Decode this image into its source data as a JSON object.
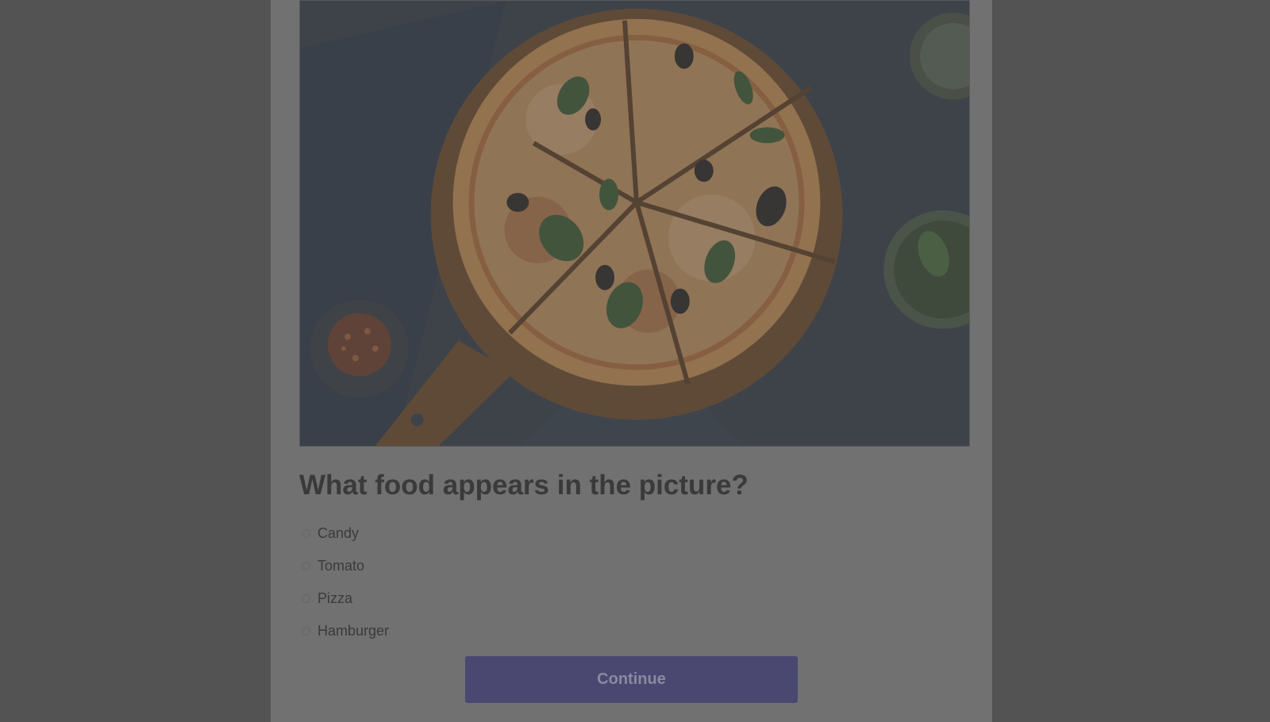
{
  "quiz": {
    "image": {
      "subject": "pizza-photo"
    },
    "question": "What food appears in the picture?",
    "options": [
      {
        "label": "Candy",
        "selected": false
      },
      {
        "label": "Tomato",
        "selected": false
      },
      {
        "label": "Pizza",
        "selected": false
      },
      {
        "label": "Hamburger",
        "selected": false
      }
    ],
    "continue_label": "Continue"
  },
  "colors": {
    "backdrop": "#535353",
    "card": "#717171",
    "button": "#4a4771",
    "text": "#3a3a3a"
  }
}
